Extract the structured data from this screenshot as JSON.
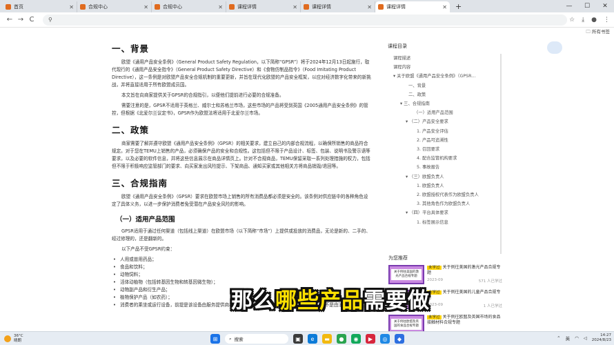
{
  "tabs": [
    {
      "label": "首页",
      "active": false
    },
    {
      "label": "合规中心",
      "active": false
    },
    {
      "label": "合规中心",
      "active": false
    },
    {
      "label": "课程详情",
      "active": false
    },
    {
      "label": "课程详情",
      "active": false
    },
    {
      "label": "课程详情",
      "active": true
    }
  ],
  "toolbar": {
    "new_tab": "+",
    "minimize": "—",
    "maximize": "☐",
    "close": "✕"
  },
  "address": {
    "back": "←",
    "forward": "→",
    "reload": "C",
    "url": ""
  },
  "bookmarks": {
    "all": "所有书签"
  },
  "article": {
    "sec1_title": "一、背景",
    "sec1_p1": "欧盟《通用产品安全条例》（General Product Safety Regulation，以下简称“GPSR”）将于2024年12月13日起施行，取代现行的《通用产品安全指令》（General Product Safety Directive）和《食物仿制品指令》（Food Imitating Product Directive），这一条例是对欧盟产品安全合规机制的重要更新，并旨在现代化欧盟的产品安全框架，以应对经济数字化带来的新挑战，并将直接适用于所有欧盟成员国。",
    "sec1_p2": "本文旨在向商家提供关于GPSR的合规指引，以便他们提前进行必要的合规准备。",
    "sec1_p3": "需要注意的是，GPSR不适用于英格兰、威尔士和苏格兰市场，这些市场的产品将受到英国《2005通用产品安全条例》的管控，但根据《北爱尔兰议定书》，GPSR作为欧盟法将适用于北爱尔兰市场。",
    "sec2_title": "二、政策",
    "sec2_p1": "商家需要了解并遵守欧盟《通用产品安全条例》（GPSR）的相关要求，建立自己的内部合规流程，以确保所销售的商品符合规定。对于您在TEMU上销售的产品，必须确保产品的安全和合规性。这包括但不限于产品设计、标签、包装、说明书及警示语等要求，以及必要的软件信息，并将这些信息展示在商品详情页上。针对不合规商品，TEMU保留采取一系列处理措施的权力，包括但不限于积极响应监管部门的要求、向买家发出风险提示、下架商品、通知买家或其他相关方将商品销毁/退回等。",
    "sec3_title": "三、合规指南",
    "sec3_p1": "欧盟《通用产品安全条例》（GPSR）要求在欧盟市场上销售的所有消费品都必须是安全的。该条例对供应链中的各种角色设定了具体义务，以进一步保护消费者免受潜在产品安全风险的影响。",
    "sub1_title": "（一）适用产品范围",
    "sub1_p1": "GPSR适用于通过任何渠道（包括线上渠道）在欧盟市场（以下简称“市场”）上提供或投放的消费品，无论是新的、二手的、经过修理的，还是翻新的。",
    "sub1_p2": "以下产品不受GPSR约束：",
    "list": [
      "人用或兽用药品；",
      "食品和饮料；",
      "动物饲料；",
      "活体动植物（包括转基因生物和转基因微生物）；",
      "动物副产品和衍生产品；",
      "植物保护产品（如农药）；",
      "消费者的乘坐或运行设备，前提是该设备由服务提供商在为消费者提供的运输服务范围内直接操作，而不是由消费者本"
    ]
  },
  "sidebar": {
    "title": "课程目录",
    "toc": [
      "课程描述",
      "课程内容",
      "关于欧盟《通用产品安全条例》（GPSR…",
      "一、背景",
      "二、政策",
      "三、合规指南",
      "（一）适用产品范围",
      "（二）产品安全要求",
      "1. 产品安全评估",
      "2. 产品可追溯性",
      "3. 召回要求",
      "4. 配合监管机构要求",
      "5. 事故报告",
      "（三）欧盟负责人",
      "1. 欧盟负责人",
      "2. 欧盟授权代表作为欧盟负责人",
      "3. 其他角色作为欧盟负责人",
      "（四）平台具体要求",
      "1. 标签展示信息"
    ],
    "rec_title": "为您推荐",
    "recs": [
      {
        "thumb": "关于例往美国的激光产品合规专题",
        "tag": "未学过",
        "title": "关于例往美国的激光产品合规专题",
        "meta_left": "2023-09",
        "meta_right": "571 人已学过"
      },
      {
        "thumb": "关于例往美国的儿童产品合规专题",
        "tag": "未学过",
        "title": "关于例往美国的儿童产品合规专题",
        "meta_left": "2023-09",
        "meta_right": "1 人已学过"
      },
      {
        "thumb": "关于例往欧盟及英国的食品合规专题",
        "tag": "未学过",
        "title": "关于例往欧盟及英国市场的食品接触材料合规专题",
        "meta_left": "",
        "meta_right": ""
      }
    ]
  },
  "caption": {
    "pre": "那么",
    "hl": "哪些产品",
    "post": "需要做"
  },
  "taskbar": {
    "temp": "36°C",
    "weather": "晴朗",
    "search": "搜索",
    "lang1": "英",
    "time": "14:27",
    "date": "2024/8/23"
  }
}
